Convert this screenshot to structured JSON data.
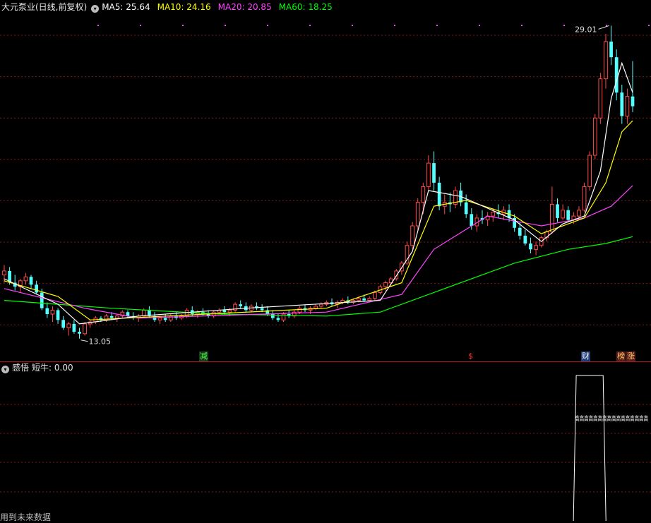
{
  "header": {
    "title": "大元泵业(日线,前复权)",
    "ma5": "MA5: 25.64",
    "ma10": "MA10: 24.16",
    "ma20": "MA20: 20.85",
    "ma60": "MA60: 18.25"
  },
  "colors": {
    "up": "#ff4b4b",
    "down": "#54ffff",
    "ma5": "#ffffff",
    "ma10": "#ffff00",
    "ma20": "#ff44ff",
    "ma60": "#00ff00",
    "grid": "#7a1a1a",
    "divider": "#b01818"
  },
  "price_labels": {
    "high": "29.01",
    "low": "13.05"
  },
  "markers": [
    {
      "text": "减",
      "color": "#44ff44",
      "bg": "#1c3a1c"
    },
    {
      "text": "$",
      "color": "#ff3030",
      "bg": "transparent"
    },
    {
      "text": "财",
      "color": "#ffffff",
      "bg": "#1c3a78"
    },
    {
      "text": "榜",
      "color": "#ffcc66",
      "bg": "#5a1a1a"
    },
    {
      "text": "涨",
      "color": "#ffcc66",
      "bg": "#5a1a1a"
    }
  ],
  "indicator": {
    "name": "感悟",
    "label": "短牛: 0.00",
    "signal_text": "高高高高高高高高高高高高高高高高"
  },
  "bottom_note": "用到未来数据",
  "chart_data": {
    "type": "candlestick",
    "title": "大元泵业(日线,前复权)",
    "ylim": [
      12.5,
      29.6
    ],
    "candles": [
      [
        16.3,
        16.8,
        15.9,
        16.5
      ],
      [
        16.5,
        16.7,
        15.8,
        15.9
      ],
      [
        15.9,
        16.3,
        15.5,
        15.7
      ],
      [
        15.7,
        16.1,
        15.4,
        16.0
      ],
      [
        16.0,
        16.4,
        15.8,
        16.2
      ],
      [
        16.2,
        16.3,
        15.6,
        15.8
      ],
      [
        15.8,
        16.0,
        15.3,
        15.4
      ],
      [
        15.4,
        15.6,
        14.5,
        14.6
      ],
      [
        14.6,
        14.9,
        14.1,
        14.3
      ],
      [
        14.3,
        14.7,
        13.9,
        14.5
      ],
      [
        14.5,
        14.6,
        13.8,
        14.0
      ],
      [
        14.0,
        14.2,
        13.5,
        13.6
      ],
      [
        13.6,
        13.9,
        13.2,
        13.8
      ],
      [
        13.8,
        14.0,
        13.3,
        13.4
      ],
      [
        13.4,
        13.6,
        13.05,
        13.3
      ],
      [
        13.3,
        13.9,
        13.2,
        13.8
      ],
      [
        13.8,
        14.0,
        13.6,
        13.9
      ],
      [
        13.9,
        14.2,
        13.8,
        14.1
      ],
      [
        14.1,
        14.2,
        13.9,
        14.0
      ],
      [
        14.0,
        14.3,
        13.9,
        14.2
      ],
      [
        14.2,
        14.4,
        14.0,
        14.1
      ],
      [
        14.1,
        14.3,
        13.9,
        14.2
      ],
      [
        14.2,
        14.5,
        14.1,
        14.4
      ],
      [
        14.4,
        14.5,
        14.1,
        14.2
      ],
      [
        14.2,
        14.4,
        14.0,
        14.1
      ],
      [
        14.1,
        14.3,
        13.9,
        14.2
      ],
      [
        14.2,
        14.6,
        14.1,
        14.5
      ],
      [
        14.5,
        14.7,
        14.1,
        14.2
      ],
      [
        14.2,
        14.4,
        13.9,
        14.0
      ],
      [
        14.0,
        14.2,
        13.8,
        14.1
      ],
      [
        14.1,
        14.3,
        13.9,
        14.0
      ],
      [
        14.0,
        14.3,
        13.9,
        14.2
      ],
      [
        14.2,
        14.4,
        14.0,
        14.1
      ],
      [
        14.1,
        14.3,
        14.0,
        14.2
      ],
      [
        14.2,
        14.6,
        14.1,
        14.5
      ],
      [
        14.5,
        14.7,
        14.2,
        14.3
      ],
      [
        14.3,
        14.5,
        14.1,
        14.4
      ],
      [
        14.4,
        14.6,
        14.2,
        14.3
      ],
      [
        14.3,
        14.5,
        14.1,
        14.2
      ],
      [
        14.2,
        14.5,
        14.1,
        14.4
      ],
      [
        14.4,
        14.6,
        14.3,
        14.5
      ],
      [
        14.5,
        14.7,
        14.3,
        14.4
      ],
      [
        14.4,
        14.6,
        14.2,
        14.5
      ],
      [
        14.5,
        14.9,
        14.4,
        14.8
      ],
      [
        14.8,
        15.0,
        14.6,
        14.7
      ],
      [
        14.7,
        14.9,
        14.4,
        14.5
      ],
      [
        14.5,
        14.8,
        14.4,
        14.7
      ],
      [
        14.7,
        14.9,
        14.5,
        14.6
      ],
      [
        14.6,
        14.8,
        14.4,
        14.5
      ],
      [
        14.5,
        14.7,
        14.2,
        14.3
      ],
      [
        14.3,
        14.5,
        14.0,
        14.1
      ],
      [
        14.1,
        14.3,
        13.9,
        14.0
      ],
      [
        14.0,
        14.4,
        13.9,
        14.3
      ],
      [
        14.3,
        14.5,
        14.1,
        14.2
      ],
      [
        14.2,
        14.5,
        14.1,
        14.4
      ],
      [
        14.4,
        14.7,
        14.3,
        14.6
      ],
      [
        14.6,
        14.8,
        14.4,
        14.5
      ],
      [
        14.5,
        14.7,
        14.3,
        14.6
      ],
      [
        14.6,
        14.8,
        14.5,
        14.7
      ],
      [
        14.7,
        14.9,
        14.6,
        14.8
      ],
      [
        14.8,
        15.0,
        14.7,
        14.9
      ],
      [
        14.9,
        15.1,
        14.7,
        14.8
      ],
      [
        14.8,
        15.0,
        14.6,
        14.9
      ],
      [
        14.9,
        15.1,
        14.8,
        15.0
      ],
      [
        15.0,
        15.2,
        14.8,
        14.9
      ],
      [
        14.9,
        15.1,
        14.8,
        15.0
      ],
      [
        15.0,
        15.2,
        14.9,
        15.1
      ],
      [
        15.1,
        15.3,
        14.9,
        15.0
      ],
      [
        15.0,
        15.2,
        14.9,
        15.1
      ],
      [
        15.1,
        15.5,
        15.0,
        15.4
      ],
      [
        15.4,
        15.8,
        15.3,
        15.7
      ],
      [
        15.7,
        16.0,
        15.5,
        15.9
      ],
      [
        15.9,
        16.2,
        15.7,
        16.1
      ],
      [
        16.1,
        16.6,
        16.0,
        16.5
      ],
      [
        16.5,
        17.0,
        16.3,
        16.9
      ],
      [
        16.9,
        18.0,
        16.8,
        17.8
      ],
      [
        17.8,
        19.0,
        17.6,
        18.8
      ],
      [
        18.8,
        20.2,
        18.6,
        20.0
      ],
      [
        20.0,
        21.0,
        19.4,
        20.8
      ],
      [
        20.8,
        22.4,
        20.6,
        22.0
      ],
      [
        22.0,
        22.6,
        20.6,
        21.0
      ],
      [
        21.0,
        21.3,
        19.6,
        19.8
      ],
      [
        19.8,
        20.4,
        19.4,
        20.0
      ],
      [
        20.0,
        20.5,
        19.5,
        19.9
      ],
      [
        19.9,
        20.8,
        19.7,
        20.6
      ],
      [
        20.6,
        21.0,
        19.8,
        20.0
      ],
      [
        20.0,
        20.4,
        19.2,
        19.4
      ],
      [
        19.4,
        19.7,
        18.6,
        18.8
      ],
      [
        18.8,
        19.4,
        18.5,
        19.2
      ],
      [
        19.2,
        19.6,
        18.9,
        19.1
      ],
      [
        19.1,
        19.5,
        18.8,
        19.3
      ],
      [
        19.3,
        19.7,
        19.0,
        19.5
      ],
      [
        19.5,
        19.9,
        19.2,
        19.4
      ],
      [
        19.4,
        19.8,
        19.1,
        19.6
      ],
      [
        19.6,
        19.9,
        19.0,
        19.2
      ],
      [
        19.2,
        19.4,
        18.5,
        18.7
      ],
      [
        18.7,
        19.0,
        18.1,
        18.3
      ],
      [
        18.3,
        18.6,
        17.8,
        17.9
      ],
      [
        17.9,
        18.2,
        17.4,
        17.6
      ],
      [
        17.6,
        18.0,
        17.3,
        17.8
      ],
      [
        17.8,
        18.3,
        17.7,
        18.2
      ],
      [
        18.2,
        18.6,
        18.0,
        18.5
      ],
      [
        18.5,
        20.8,
        18.4,
        19.9
      ],
      [
        19.9,
        20.2,
        19.0,
        19.2
      ],
      [
        19.2,
        19.9,
        19.1,
        19.6
      ],
      [
        19.6,
        19.8,
        19.0,
        19.1
      ],
      [
        19.1,
        19.5,
        18.9,
        19.3
      ],
      [
        19.3,
        19.8,
        19.1,
        19.6
      ],
      [
        19.6,
        21.0,
        19.5,
        20.8
      ],
      [
        20.8,
        22.6,
        20.6,
        22.4
      ],
      [
        22.4,
        24.5,
        22.2,
        24.3
      ],
      [
        24.3,
        26.6,
        24.0,
        26.3
      ],
      [
        26.3,
        28.6,
        25.8,
        28.2
      ],
      [
        28.2,
        29.01,
        27.0,
        27.4
      ],
      [
        27.4,
        27.8,
        25.2,
        25.6
      ],
      [
        25.6,
        26.0,
        24.0,
        24.4
      ],
      [
        24.4,
        25.8,
        24.0,
        25.4
      ],
      [
        25.4,
        27.2,
        24.6,
        24.9
      ]
    ],
    "ma5": [
      [
        0,
        16.1
      ],
      [
        10,
        14.8
      ],
      [
        14,
        13.8
      ],
      [
        25,
        14.2
      ],
      [
        45,
        14.6
      ],
      [
        70,
        15.0
      ],
      [
        76,
        17.5
      ],
      [
        79,
        20.6
      ],
      [
        85,
        20.3
      ],
      [
        95,
        19.1
      ],
      [
        100,
        18.0
      ],
      [
        104,
        18.9
      ],
      [
        108,
        19.3
      ],
      [
        111,
        21.6
      ],
      [
        113,
        25.3
      ],
      [
        115,
        27.1
      ],
      [
        117,
        25.6
      ]
    ],
    "ma10": [
      [
        0,
        16.0
      ],
      [
        10,
        15.2
      ],
      [
        16,
        14.0
      ],
      [
        30,
        14.2
      ],
      [
        60,
        14.6
      ],
      [
        74,
        15.9
      ],
      [
        80,
        19.8
      ],
      [
        86,
        20.1
      ],
      [
        95,
        19.3
      ],
      [
        100,
        18.4
      ],
      [
        108,
        19.2
      ],
      [
        112,
        21.0
      ],
      [
        115,
        23.6
      ],
      [
        117,
        24.16
      ]
    ],
    "ma20": [
      [
        0,
        15.6
      ],
      [
        15,
        14.6
      ],
      [
        25,
        14.1
      ],
      [
        60,
        14.4
      ],
      [
        74,
        15.3
      ],
      [
        80,
        17.6
      ],
      [
        90,
        19.3
      ],
      [
        100,
        18.8
      ],
      [
        108,
        19.2
      ],
      [
        113,
        19.8
      ],
      [
        117,
        20.85
      ]
    ],
    "ma60": [
      [
        0,
        15.0
      ],
      [
        20,
        14.6
      ],
      [
        40,
        14.3
      ],
      [
        60,
        14.2
      ],
      [
        70,
        14.4
      ],
      [
        80,
        15.4
      ],
      [
        95,
        16.9
      ],
      [
        105,
        17.6
      ],
      [
        112,
        17.9
      ],
      [
        117,
        18.25
      ]
    ],
    "indicator_ylim": [
      0,
      1
    ],
    "indicator_segments": [
      {
        "start": 107,
        "end": 111,
        "value": 1
      }
    ]
  }
}
